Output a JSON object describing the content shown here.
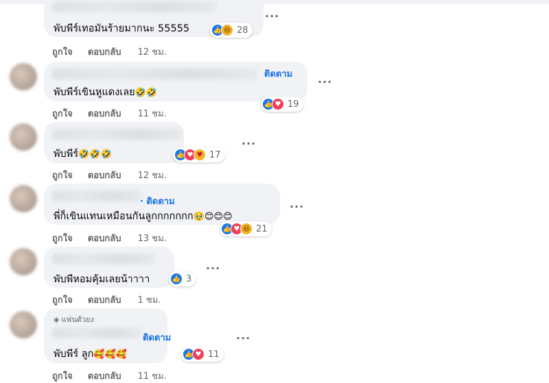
{
  "comments": [
    {
      "follow": "",
      "fan_badge": "",
      "text": "พับพีร์เทอมันร้ายมากนะ 55555",
      "emojis": "",
      "reaction_count": "28",
      "like": "ถูกใจ",
      "reply": "ตอบกลับ",
      "time": "12 ชม."
    },
    {
      "follow": "ติดตาม",
      "fan_badge": "",
      "text": "พับพีร์เขินหูแดงเลย",
      "emojis": "🤣🤣",
      "reaction_count": "19",
      "like": "ถูกใจ",
      "reply": "ตอบกลับ",
      "time": "11 ชม."
    },
    {
      "follow": "",
      "fan_badge": "",
      "text": "พับพีร์",
      "emojis": "🤣🤣🤣",
      "reaction_count": "17",
      "like": "ถูกใจ",
      "reply": "ตอบกลับ",
      "time": "12 ชม."
    },
    {
      "follow": "· ติดตาม",
      "fan_badge": "",
      "text": "พี่ก็เขินแทนเหมือนกันลูกกกกกกก",
      "emojis": "🥹😊😊😊",
      "reaction_count": "21",
      "like": "ถูกใจ",
      "reply": "ตอบกลับ",
      "time": "13 ชม."
    },
    {
      "follow": "",
      "fan_badge": "",
      "text": "พับพีหอมคุ้มเลยน้าาาา",
      "emojis": "",
      "reaction_count": "3",
      "like": "ถูกใจ",
      "reply": "ตอบกลับ",
      "time": "1 ชม."
    },
    {
      "follow": "ติดตาม",
      "fan_badge": "แฟนตัวยง",
      "text": "พับพีร์ ลูก",
      "emojis": "🥰🥰🥰",
      "reaction_count": "11",
      "like": "ถูกใจ",
      "reply": "ตอบกลับ",
      "time": "11 ชม."
    }
  ],
  "more_options": "···",
  "icons": {
    "like": "thumbs-up-icon",
    "love": "heart-icon",
    "haha": "laughing-face-icon",
    "care": "care-hug-icon",
    "fan": "diamond-icon"
  },
  "colors": {
    "bubble": "#f0f2f5",
    "follow": "#1b74e4",
    "like": "#1877f2",
    "love": "#f33e58",
    "secondary_text": "#65676b"
  }
}
